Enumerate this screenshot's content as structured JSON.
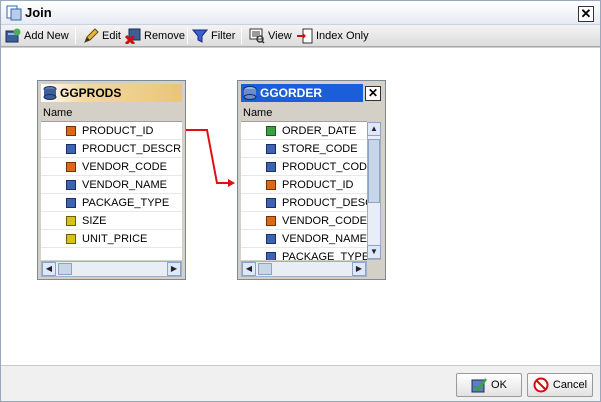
{
  "window": {
    "title": "Join",
    "close_symbol": "✕"
  },
  "toolbar": {
    "add_new": "Add New",
    "edit": "Edit",
    "remove": "Remove",
    "filter": "Filter",
    "view": "View",
    "index_only": "Index Only"
  },
  "tables": [
    {
      "name": "GGPRODS",
      "column_header": "Name",
      "fields": [
        {
          "label": "PRODUCT_ID",
          "icon": "key-icon"
        },
        {
          "label": "PRODUCT_DESCRI...",
          "icon": "field-icon"
        },
        {
          "label": "VENDOR_CODE",
          "icon": "key-icon"
        },
        {
          "label": "VENDOR_NAME",
          "icon": "field-icon"
        },
        {
          "label": "PACKAGE_TYPE",
          "icon": "field-icon"
        },
        {
          "label": "SIZE",
          "icon": "numeric-icon"
        },
        {
          "label": "UNIT_PRICE",
          "icon": "numeric-icon"
        }
      ]
    },
    {
      "name": "GGORDER",
      "column_header": "Name",
      "close_symbol": "✕",
      "fields": [
        {
          "label": "ORDER_DATE",
          "icon": "date-icon"
        },
        {
          "label": "STORE_CODE",
          "icon": "field-icon"
        },
        {
          "label": "PRODUCT_CODE",
          "icon": "field-icon"
        },
        {
          "label": "PRODUCT_ID",
          "icon": "key-icon"
        },
        {
          "label": "PRODUCT_DESCR",
          "icon": "field-icon"
        },
        {
          "label": "VENDOR_CODE",
          "icon": "key-icon"
        },
        {
          "label": "VENDOR_NAME",
          "icon": "field-icon"
        },
        {
          "label": "PACKAGE_TYPE",
          "icon": "field-icon"
        }
      ]
    }
  ],
  "join": {
    "from": "GGPRODS.PRODUCT_ID",
    "to": "GGORDER.PRODUCT_ID",
    "color": "#e01010"
  },
  "footer": {
    "ok": "OK",
    "cancel": "Cancel"
  },
  "colors": {
    "accent_blue": "#1a5fd7",
    "header_gold": "#e9c57a"
  }
}
